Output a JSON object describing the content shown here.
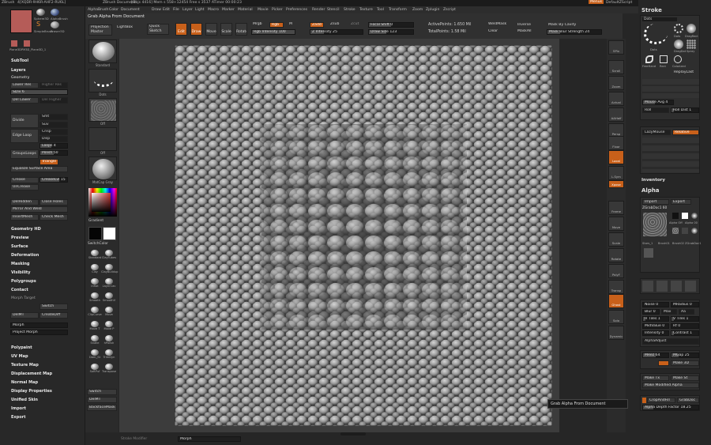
{
  "titlebar": {
    "app": "ZBrush",
    "version": "4[XQDR-9H6R-AHF2-RU6L]",
    "doc": "ZBrush Document",
    "stats": "[Objs 4416] Mem s 558+12454 Free s 3537 ATimer 00:00:23",
    "menus_label": "Menus",
    "script_label": "DefaultZScript"
  },
  "menubar": [
    "Alpha",
    "Brush",
    "Color",
    "Document",
    "Draw",
    "Edit",
    "File",
    "Layer",
    "Light",
    "Macro",
    "Marker",
    "Material",
    "Movie",
    "Picker",
    "Preferences",
    "Render",
    "Stencil",
    "Stroke",
    "Texture",
    "Tool",
    "Transform",
    "Zoom",
    "Zplugin",
    "Zscript"
  ],
  "header_tip": "Grab Alpha From Document",
  "toolbar": {
    "projection": "Projection Master",
    "lightbox": "LightBox",
    "quick_sketch": "Quick Sketch",
    "edit": "Edit",
    "draw": "Draw",
    "move": "Move",
    "scale": "Scale",
    "rotate": "Rotate",
    "mrgb": "Mrgb",
    "rgb": "Rgb",
    "m": "M",
    "rgb_intensity": "Rgb Intensity 100",
    "zadd": "Zadd",
    "zsub": "Zsub",
    "zcut": "Zcut",
    "z_intensity": "Z Intensity 25",
    "focal_shift": "Focal Shift 0",
    "draw_size": "Draw Size 123",
    "active_points": "ActivePoints: 1.650 Mil",
    "total_points": "TotalPoints: 1.58 Mil",
    "weld_mask": "WeldMask",
    "clear": "Clear",
    "inverse": "Inverse",
    "mask_all": "MaskAll",
    "mask_by_cavity": "Mask By Cavity",
    "mask_blur": "Mask Blur Strength 24"
  },
  "left_top": {
    "swatches": [
      "Sphere3D",
      "AlphaBrush",
      "SimpleBrush",
      "Eraser3D",
      "Plane3D",
      "PM3D_Plane3D_1"
    ]
  },
  "left_panel": {
    "subtool": "SubTool",
    "layers": "Layers",
    "geometry": "Geometry",
    "lower_res": "Lower Res",
    "higher_res": "Higher Res",
    "sdiv": "SDiv 6",
    "del_lower": "Del Lower",
    "del_higher": "Del Higher",
    "divide": "Divide",
    "smt": "Smt",
    "suv": "Suv",
    "edge_loop": "Edge Loop",
    "crisp": "Crisp",
    "disp": "Disp",
    "loops": "Loops 4",
    "groups_loops": "GroupsLoops",
    "polish": "Polish 50",
    "triangle": "Triangle",
    "equalize": "Equalize Surface Area",
    "crease": "Crease",
    "creaselvl": "CreaseLvl 15",
    "uncrease": "UnCrease",
    "del_hidden": "DelHidden",
    "close_holes": "Close Holes",
    "mirror_weld": "Mirror And Weld",
    "insert_mesh": "InsertMesh",
    "check_mesh": "Check Mesh",
    "geometry_hd": "Geometry HD",
    "preview": "Preview",
    "surface": "Surface",
    "deformation": "Deformation",
    "masking": "Masking",
    "visibility": "Visibility",
    "polygroups": "Polygroups",
    "contact": "Contact",
    "morph_target": "Morph Target",
    "switch": "Switch",
    "delmt": "DelMT",
    "create_diff": "CreateDiff",
    "morph": "Morph",
    "project_morph": "Project Morph",
    "polypaint": "Polypaint",
    "uv_map": "UV Map",
    "texture_map": "Texture Map",
    "displacement_map": "Displacement Map",
    "normal_map": "Normal Map",
    "display_properties": "Display Properties",
    "unified_skin": "Unified Skin",
    "import": "Import",
    "export": "Export"
  },
  "shelf": {
    "brush": "Standard",
    "stroke": "Dots",
    "alpha": "Off",
    "texture": "Off",
    "material": "MatCap Gray",
    "gradient": "Gradient",
    "switch_color": "SwitchColor",
    "brushes": [
      "Standard",
      "ClayTubes",
      "Clay",
      "ClayBuildup",
      "Inflat",
      "LayerCav",
      "Smooth",
      "SmoothV",
      "ClipCurve",
      "Move",
      "Move T",
      "Move P",
      "Snake",
      "hPolish",
      "Dam_St",
      "TrimDyn",
      "SoftPuf",
      "Transpose"
    ],
    "switch": "Switch",
    "delmt": "DelMT",
    "backface": "BackfaceMask"
  },
  "right_shelf": [
    "SPix",
    "Scroll",
    "Zoom",
    "Actual",
    "AAHalf",
    "Persp",
    "Floor",
    "Local",
    "L.Sym",
    "Xpose",
    "Frame",
    "Move",
    "Scale",
    "Rotate",
    "PolyF",
    "Transp",
    "Ghost",
    "Solo",
    "Dynamic"
  ],
  "stroke_panel": {
    "title": "Stroke",
    "dots": "Dots",
    "dots_label": "Dots",
    "types": [
      "Dots",
      "DragRect",
      "Spray",
      "DragDot",
      "FreeHand",
      "Rect",
      "Colorized"
    ],
    "replay_last": "ReplayLast",
    "mouse_avg": "Mouse Avg 4",
    "roll": "Roll",
    "roll_dist": "Roll Dist 1",
    "lazy_mouse": "LazyMouse",
    "relative": "Relative"
  },
  "inventory": "Inventory",
  "alpha_panel": {
    "title": "Alpha",
    "import": "Import",
    "export": "Export",
    "current": "ZGrabDoc1 60",
    "alpha_off": "Alpha Off",
    "alphas": [
      "ZGrabDoc1",
      "Alpha 00",
      "Alpha 09",
      "Stars_1",
      "Brush01",
      "Brush02",
      "Scale"
    ],
    "noise": "Noise 0",
    "mradius": "MRadius 0",
    "blur": "Blur 0",
    "max": "Max",
    "aa": "Aa",
    "htiles": "H Tiles 1",
    "vtiles": "V Tiles 1",
    "midvalue": "MidValue 0",
    "rf": "Rf 0",
    "intensity": "Intensity 0",
    "contrast": "Contrast 1",
    "alpha_adjust": "AlphaAdjust",
    "mrez": "MRez 64",
    "mgap": "MGap 25",
    "make_3d": "Make 3D",
    "make_tx": "Make Tx",
    "make_st": "Make St",
    "make_modified": "Make Modified Alpha",
    "crop_fill": "CropAndFill",
    "grab_doc": "GrabDoc",
    "depth_factor": "Alpha Depth Factor 18.25"
  },
  "tooltip": "Grab Alpha From Document",
  "bottom": {
    "morph": "Morph",
    "stroke_modifier": "Stroke Modifier"
  },
  "colors": {
    "accent": "#c8601a",
    "bg": "#262626",
    "panel": "#2e2e2e"
  }
}
